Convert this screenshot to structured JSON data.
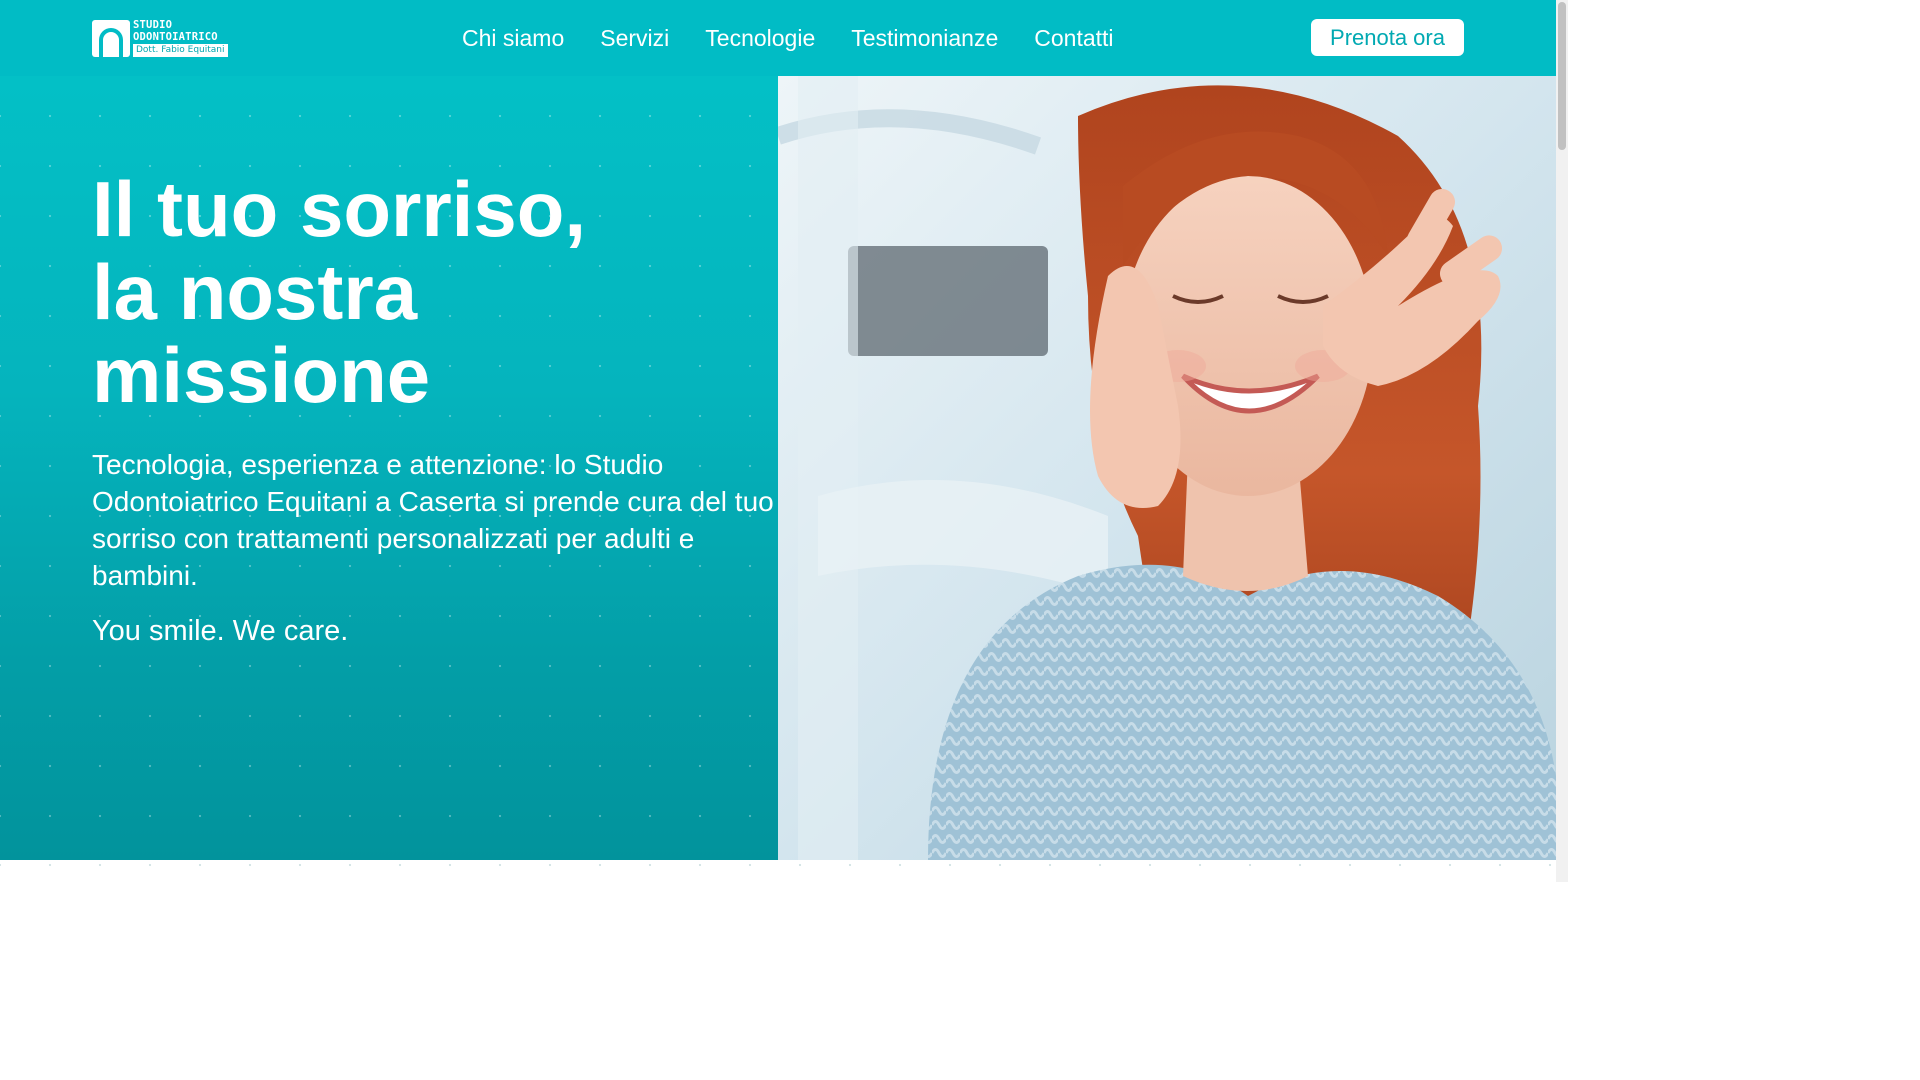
{
  "brand": {
    "logo_line1": "STUDIO",
    "logo_line2": "ODONTOIATRICO",
    "logo_line3": "Dott. Fabio Equitani"
  },
  "nav": {
    "items": [
      {
        "label": "Chi siamo"
      },
      {
        "label": "Servizi"
      },
      {
        "label": "Tecnologie"
      },
      {
        "label": "Testimonianze"
      },
      {
        "label": "Contatti"
      }
    ],
    "cta_label": "Prenota ora"
  },
  "hero": {
    "headline_line1": "Il tuo sorriso,",
    "headline_line2": "la nostra",
    "headline_line3": "missione",
    "lead": "Tecnologia, esperienza e attenzione: lo Studio Odontoiatrico Equitani a Caserta si prende cura del tuo sorriso con trattamenti personalizzati per adulti e bambini.",
    "tagline": "You smile. We care."
  },
  "colors": {
    "brand_teal": "#01bcc5",
    "white": "#ffffff"
  }
}
